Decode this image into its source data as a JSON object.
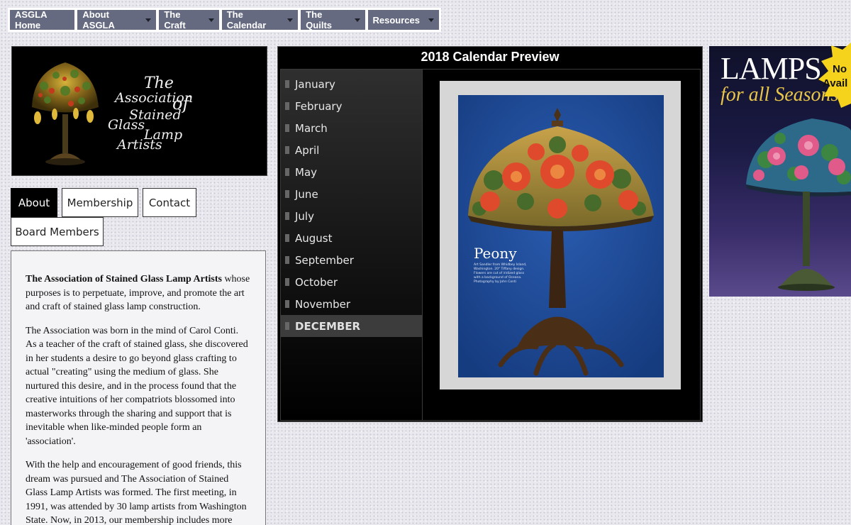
{
  "nav": {
    "items": [
      {
        "label": "ASGLA Home",
        "dropdown": false
      },
      {
        "label": "About ASGLA",
        "dropdown": true
      },
      {
        "label": "The Craft",
        "dropdown": true
      },
      {
        "label": "The Calendar",
        "dropdown": true
      },
      {
        "label": "The Quilts",
        "dropdown": true
      },
      {
        "label": "Resources",
        "dropdown": true
      }
    ]
  },
  "logo": {
    "lines": [
      "The",
      "Association",
      "of",
      "Stained",
      "Glass",
      "Lamp",
      "Artists"
    ]
  },
  "tabs": {
    "about": "About",
    "membership": "Membership",
    "contact": "Contact",
    "board": "Board Members",
    "active": "About"
  },
  "about": {
    "p1_bold": "The Association of Stained Glass Lamp Artists",
    "p1_rest": " whose purposes is to perpetuate, improve, and promote the art and craft of stained glass lamp construction.",
    "p2": "The Association was born in the mind of Carol Conti. As a teacher of the craft of stained glass, she discovered in her students a desire to go beyond glass crafting to actual \"creating\" using the medium of glass. She nurtured this desire, and in the process found that the creative intuitions of her compatriots blossomed into masterworks through the sharing and support that is inevitable when like-minded people form an 'association'.",
    "p3": "With the help and encouragement of good friends, this dream was pursued and The Association of Stained Glass Lamp Artists was formed. The first meeting, in 1991, was attended by 30 lamp artists from Washington State. Now, in 2013, our membership includes more"
  },
  "calendar": {
    "title": "2018 Calendar Preview",
    "months": [
      "January",
      "February",
      "March",
      "April",
      "May",
      "June",
      "July",
      "August",
      "September",
      "October",
      "November",
      "DECEMBER"
    ],
    "selected_index": 11,
    "preview": {
      "name": "Peony",
      "caption_lines": [
        "Art Sandler from Whidbey Island,",
        "Washington. 20\" Tiffany design.",
        "Flowers are cut of iridized glass",
        "with a background of Oceana.",
        "Photography by John Conti"
      ]
    }
  },
  "ad": {
    "title": "LAMPS",
    "subtitle": "for all Seasons",
    "badge_line1": "No",
    "badge_line2": "Avail"
  },
  "colors": {
    "nav_bg": "#656a80",
    "calendar_bg": "#000000",
    "preview_bg": "#1e4a96",
    "ad_gold": "#e9c64a"
  }
}
